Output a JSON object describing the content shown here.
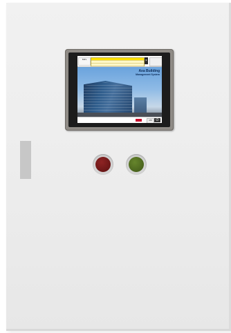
{
  "screen": {
    "logo_text": "BMS",
    "hero_title_line1": "Axa Building",
    "hero_title_line2": "Management System",
    "bottom_label": "ABB"
  },
  "colors": {
    "cabinet": "#eeeeee",
    "bezel": "#8f8b86",
    "alarm_highlight": "#ffe200",
    "red_indicator": "#5b1111",
    "green_indicator": "#3f5718"
  },
  "icons": {
    "power": "power-icon",
    "ack": "close-icon"
  }
}
